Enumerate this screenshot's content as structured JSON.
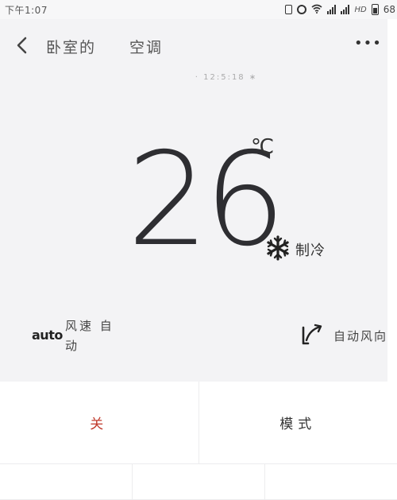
{
  "status_bar": {
    "time": "下午1:07",
    "network_label": "HD",
    "battery_level": "68"
  },
  "header": {
    "room": "卧室的",
    "device": "空调",
    "back_icon": "chevron-left-icon",
    "more_label": "•••"
  },
  "update_time": "·                         12:5:18      ∗",
  "temperature": {
    "value": "26",
    "unit": "℃"
  },
  "mode": {
    "icon": "snowflake-icon",
    "label": "制冷"
  },
  "fan_speed": {
    "icon_text": "auto",
    "label": "风速 自动"
  },
  "swing": {
    "icon": "swing-icon",
    "label": "自动风向"
  },
  "buttons": {
    "row1": [
      {
        "label": "关",
        "color": "#c0392b"
      },
      {
        "label": "模式"
      }
    ],
    "row2": [
      {
        "label": ""
      },
      {
        "label": ""
      },
      {
        "label": ""
      }
    ]
  },
  "colors": {
    "panel_bg": "#f3f3f5",
    "power_accent": "#c0392b",
    "text": "#333333"
  }
}
